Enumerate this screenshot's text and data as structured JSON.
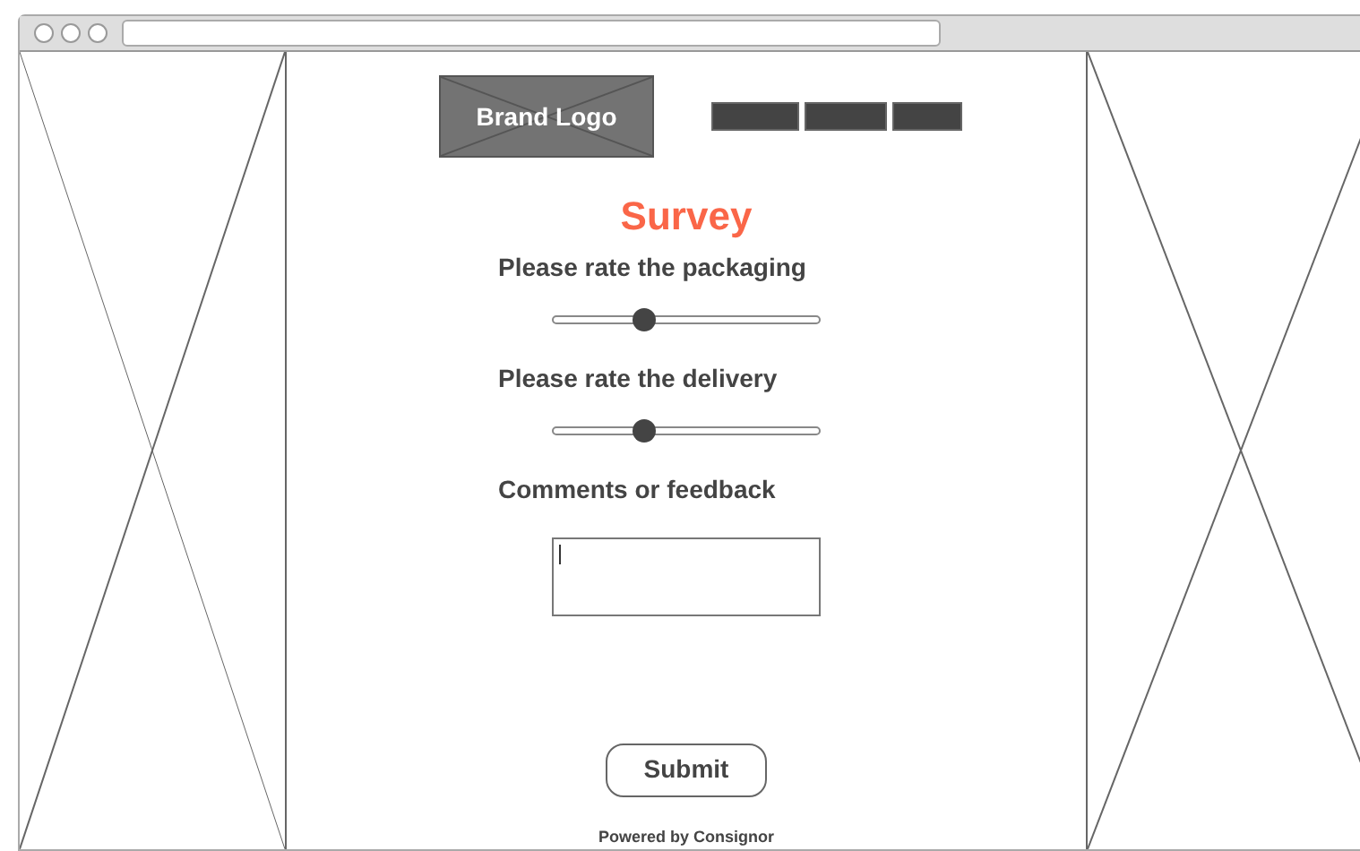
{
  "logo": {
    "text": "Brand Logo"
  },
  "nav": [
    {
      "kind": "bar"
    },
    {
      "kind": "bar"
    },
    {
      "kind": "bar"
    }
  ],
  "title": "Survey",
  "questions": [
    {
      "kind": "slider",
      "label": "Please rate the packaging",
      "level": 0.34
    },
    {
      "kind": "slider",
      "label": "Please rate the delivery",
      "level": 0.34
    },
    {
      "kind": "textarea",
      "label": "Comments or feedback",
      "focused": true
    }
  ],
  "submit": "Submit",
  "footer": "Powered by Consignor"
}
